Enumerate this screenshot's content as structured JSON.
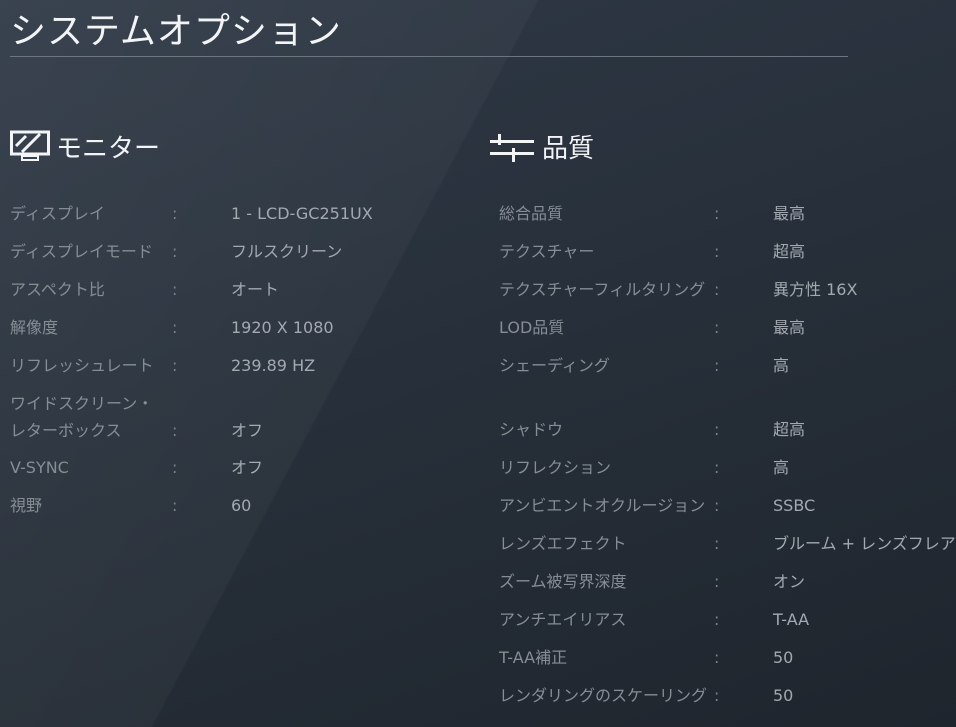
{
  "title": "システムオプション",
  "monitor": {
    "heading": "モニター",
    "icon": "monitor-icon",
    "rows": [
      {
        "label": "ディスプレイ",
        "value": "1 - LCD-GC251UX"
      },
      {
        "label": "ディスプレイモード",
        "value": "フルスクリーン"
      },
      {
        "label": "アスペクト比",
        "value": "オート"
      },
      {
        "label": "解像度",
        "value": "1920 X 1080"
      },
      {
        "label": "リフレッシュレート",
        "value": "239.89 HZ"
      },
      {
        "label": "ワイドスクリーン・",
        "label2": "レターボックス",
        "value": "オフ"
      },
      {
        "label": "V-SYNC",
        "value": "オフ"
      },
      {
        "label": "視野",
        "value": "60"
      }
    ]
  },
  "quality": {
    "heading": "品質",
    "icon": "sliders-icon",
    "rows": [
      {
        "label": "総合品質",
        "value": "最高"
      },
      {
        "label": "テクスチャー",
        "value": "超高"
      },
      {
        "label": "テクスチャーフィルタリング",
        "value": "異方性 16X"
      },
      {
        "label": "LOD品質",
        "value": "最高"
      },
      {
        "label": "シェーディング",
        "value": "高"
      },
      {
        "label": "シャドウ",
        "value": "超高"
      },
      {
        "label": "リフレクション",
        "value": "高"
      },
      {
        "label": "アンビエントオクルージョン",
        "value": "SSBC"
      },
      {
        "label": "レンズエフェクト",
        "value": "ブルーム + レンズフレア"
      },
      {
        "label": "ズーム被写界深度",
        "value": "オン"
      },
      {
        "label": "アンチエイリアス",
        "value": "T-AA"
      },
      {
        "label": "T-AA補正",
        "value": "50"
      },
      {
        "label": "レンダリングのスケーリング",
        "value": "50"
      }
    ]
  },
  "separator": ":"
}
